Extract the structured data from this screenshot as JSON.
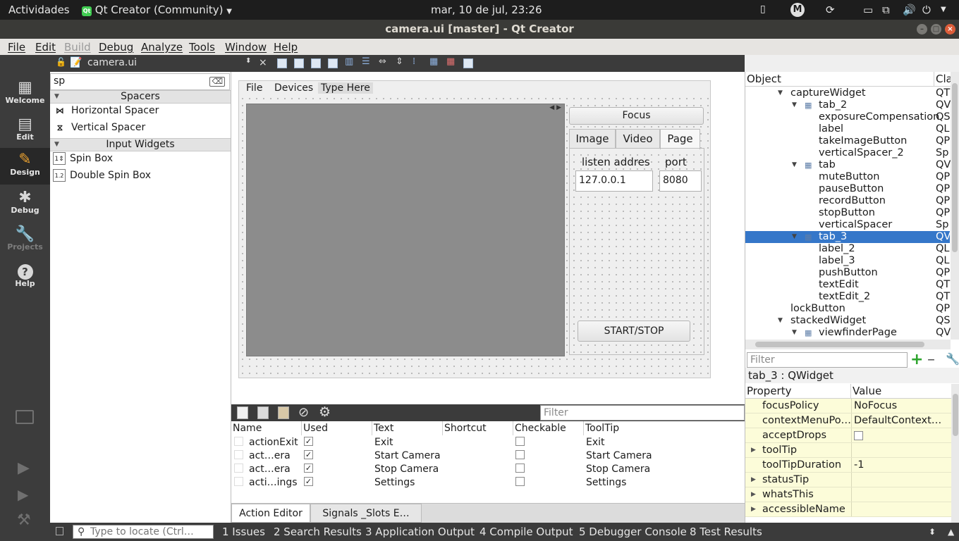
{
  "topbar": {
    "activities": "Actividades",
    "app_name": "Qt Creator (Community)",
    "clock": "mar, 10 de jul, 23:26",
    "user_initial": "M"
  },
  "window": {
    "title": "camera.ui [master] - Qt Creator"
  },
  "menu": [
    "File",
    "Edit",
    "Build",
    "Debug",
    "Analyze",
    "Tools",
    "Window",
    "Help"
  ],
  "modes": [
    {
      "label": "Welcome",
      "icon": "grid-icon"
    },
    {
      "label": "Edit",
      "icon": "document-icon"
    },
    {
      "label": "Design",
      "icon": "pencil-icon"
    },
    {
      "label": "Debug",
      "icon": "bug-icon"
    },
    {
      "label": "Projects",
      "icon": "wrench-icon"
    },
    {
      "label": "Help",
      "icon": "help-icon"
    }
  ],
  "document": {
    "file_name": "camera.ui"
  },
  "widget_box": {
    "filter": "sp",
    "categories": [
      {
        "name": "Spacers",
        "items": [
          "Horizontal Spacer",
          "Vertical Spacer"
        ]
      },
      {
        "name": "Input Widgets",
        "items": [
          "Spin Box",
          "Double Spin Box"
        ]
      }
    ]
  },
  "form": {
    "menu": [
      "File",
      "Devices",
      "Type Here"
    ],
    "focus_button": "Focus",
    "tabs": [
      "Image",
      "Video",
      "Page"
    ],
    "listen_label": "listen addres",
    "port_label": "port",
    "address_value": "127.0.0.1",
    "port_value": "8080",
    "start_stop_button": "START/STOP"
  },
  "action_editor": {
    "filter_placeholder": "Filter",
    "columns": [
      "Name",
      "Used",
      "Text",
      "Shortcut",
      "Checkable",
      "ToolTip"
    ],
    "rows": [
      {
        "name": "actionExit",
        "used": true,
        "text": "Exit",
        "shortcut": "",
        "checkable": false,
        "tooltip": "Exit"
      },
      {
        "name": "act…era",
        "used": true,
        "text": "Start Camera",
        "shortcut": "",
        "checkable": false,
        "tooltip": "Start Camera"
      },
      {
        "name": "act…era",
        "used": true,
        "text": "Stop Camera",
        "shortcut": "",
        "checkable": false,
        "tooltip": "Stop Camera"
      },
      {
        "name": "acti…ings",
        "used": true,
        "text": "Settings",
        "shortcut": "",
        "checkable": false,
        "tooltip": "Settings"
      }
    ],
    "tabs": [
      "Action Editor",
      "Signals _Slots E…"
    ]
  },
  "object_inspector": {
    "columns": [
      "Object",
      "Cla"
    ],
    "rows": [
      {
        "name": "captureWidget",
        "cls": "QT",
        "depth": 0,
        "expand": "open",
        "icon": false,
        "selected": false
      },
      {
        "name": "tab_2",
        "cls": "QV",
        "depth": 1,
        "expand": "open",
        "icon": true,
        "selected": false
      },
      {
        "name": "exposureCompensation",
        "cls": "QS",
        "depth": 2,
        "expand": "",
        "icon": false,
        "selected": false
      },
      {
        "name": "label",
        "cls": "QL",
        "depth": 2,
        "expand": "",
        "icon": false,
        "selected": false
      },
      {
        "name": "takeImageButton",
        "cls": "QP",
        "depth": 2,
        "expand": "",
        "icon": false,
        "selected": false
      },
      {
        "name": "verticalSpacer_2",
        "cls": "Sp",
        "depth": 2,
        "expand": "",
        "icon": false,
        "selected": false
      },
      {
        "name": "tab",
        "cls": "QV",
        "depth": 1,
        "expand": "open",
        "icon": true,
        "selected": false
      },
      {
        "name": "muteButton",
        "cls": "QP",
        "depth": 2,
        "expand": "",
        "icon": false,
        "selected": false
      },
      {
        "name": "pauseButton",
        "cls": "QP",
        "depth": 2,
        "expand": "",
        "icon": false,
        "selected": false
      },
      {
        "name": "recordButton",
        "cls": "QP",
        "depth": 2,
        "expand": "",
        "icon": false,
        "selected": false
      },
      {
        "name": "stopButton",
        "cls": "QP",
        "depth": 2,
        "expand": "",
        "icon": false,
        "selected": false
      },
      {
        "name": "verticalSpacer",
        "cls": "Sp",
        "depth": 2,
        "expand": "",
        "icon": false,
        "selected": false
      },
      {
        "name": "tab_3",
        "cls": "QV",
        "depth": 1,
        "expand": "open",
        "icon": true,
        "selected": true
      },
      {
        "name": "label_2",
        "cls": "QL",
        "depth": 2,
        "expand": "",
        "icon": false,
        "selected": false
      },
      {
        "name": "label_3",
        "cls": "QL",
        "depth": 2,
        "expand": "",
        "icon": false,
        "selected": false
      },
      {
        "name": "pushButton",
        "cls": "QP",
        "depth": 2,
        "expand": "",
        "icon": false,
        "selected": false
      },
      {
        "name": "textEdit",
        "cls": "QT",
        "depth": 2,
        "expand": "",
        "icon": false,
        "selected": false
      },
      {
        "name": "textEdit_2",
        "cls": "QT",
        "depth": 2,
        "expand": "",
        "icon": false,
        "selected": false
      },
      {
        "name": "lockButton",
        "cls": "QP",
        "depth": 0,
        "expand": "",
        "icon": false,
        "selected": false
      },
      {
        "name": "stackedWidget",
        "cls": "QS",
        "depth": 0,
        "expand": "open",
        "icon": false,
        "selected": false
      },
      {
        "name": "viewfinderPage",
        "cls": "QV",
        "depth": 1,
        "expand": "open",
        "icon": true,
        "selected": false
      }
    ]
  },
  "property_editor": {
    "filter_placeholder": "Filter",
    "class_label": "tab_3 : QWidget",
    "columns": [
      "Property",
      "Value"
    ],
    "rows": [
      {
        "name": "focusPolicy",
        "value": "NoFocus",
        "expandable": false,
        "checkbox": false
      },
      {
        "name": "contextMenuPo…",
        "value": "DefaultContext…",
        "expandable": false,
        "checkbox": false
      },
      {
        "name": "acceptDrops",
        "value": "",
        "expandable": false,
        "checkbox": true
      },
      {
        "name": "toolTip",
        "value": "",
        "expandable": true,
        "checkbox": false
      },
      {
        "name": "toolTipDuration",
        "value": "-1",
        "expandable": false,
        "checkbox": false
      },
      {
        "name": "statusTip",
        "value": "",
        "expandable": true,
        "checkbox": false
      },
      {
        "name": "whatsThis",
        "value": "",
        "expandable": true,
        "checkbox": false
      },
      {
        "name": "accessibleName",
        "value": "",
        "expandable": true,
        "checkbox": false
      }
    ]
  },
  "output_bar": {
    "locate_placeholder": "Type to locate (Ctrl…",
    "panes": [
      "1  Issues",
      "2  Search Results",
      "3  Application Output",
      "4  Compile Output",
      "5  Debugger Console",
      "8  Test Results"
    ]
  }
}
